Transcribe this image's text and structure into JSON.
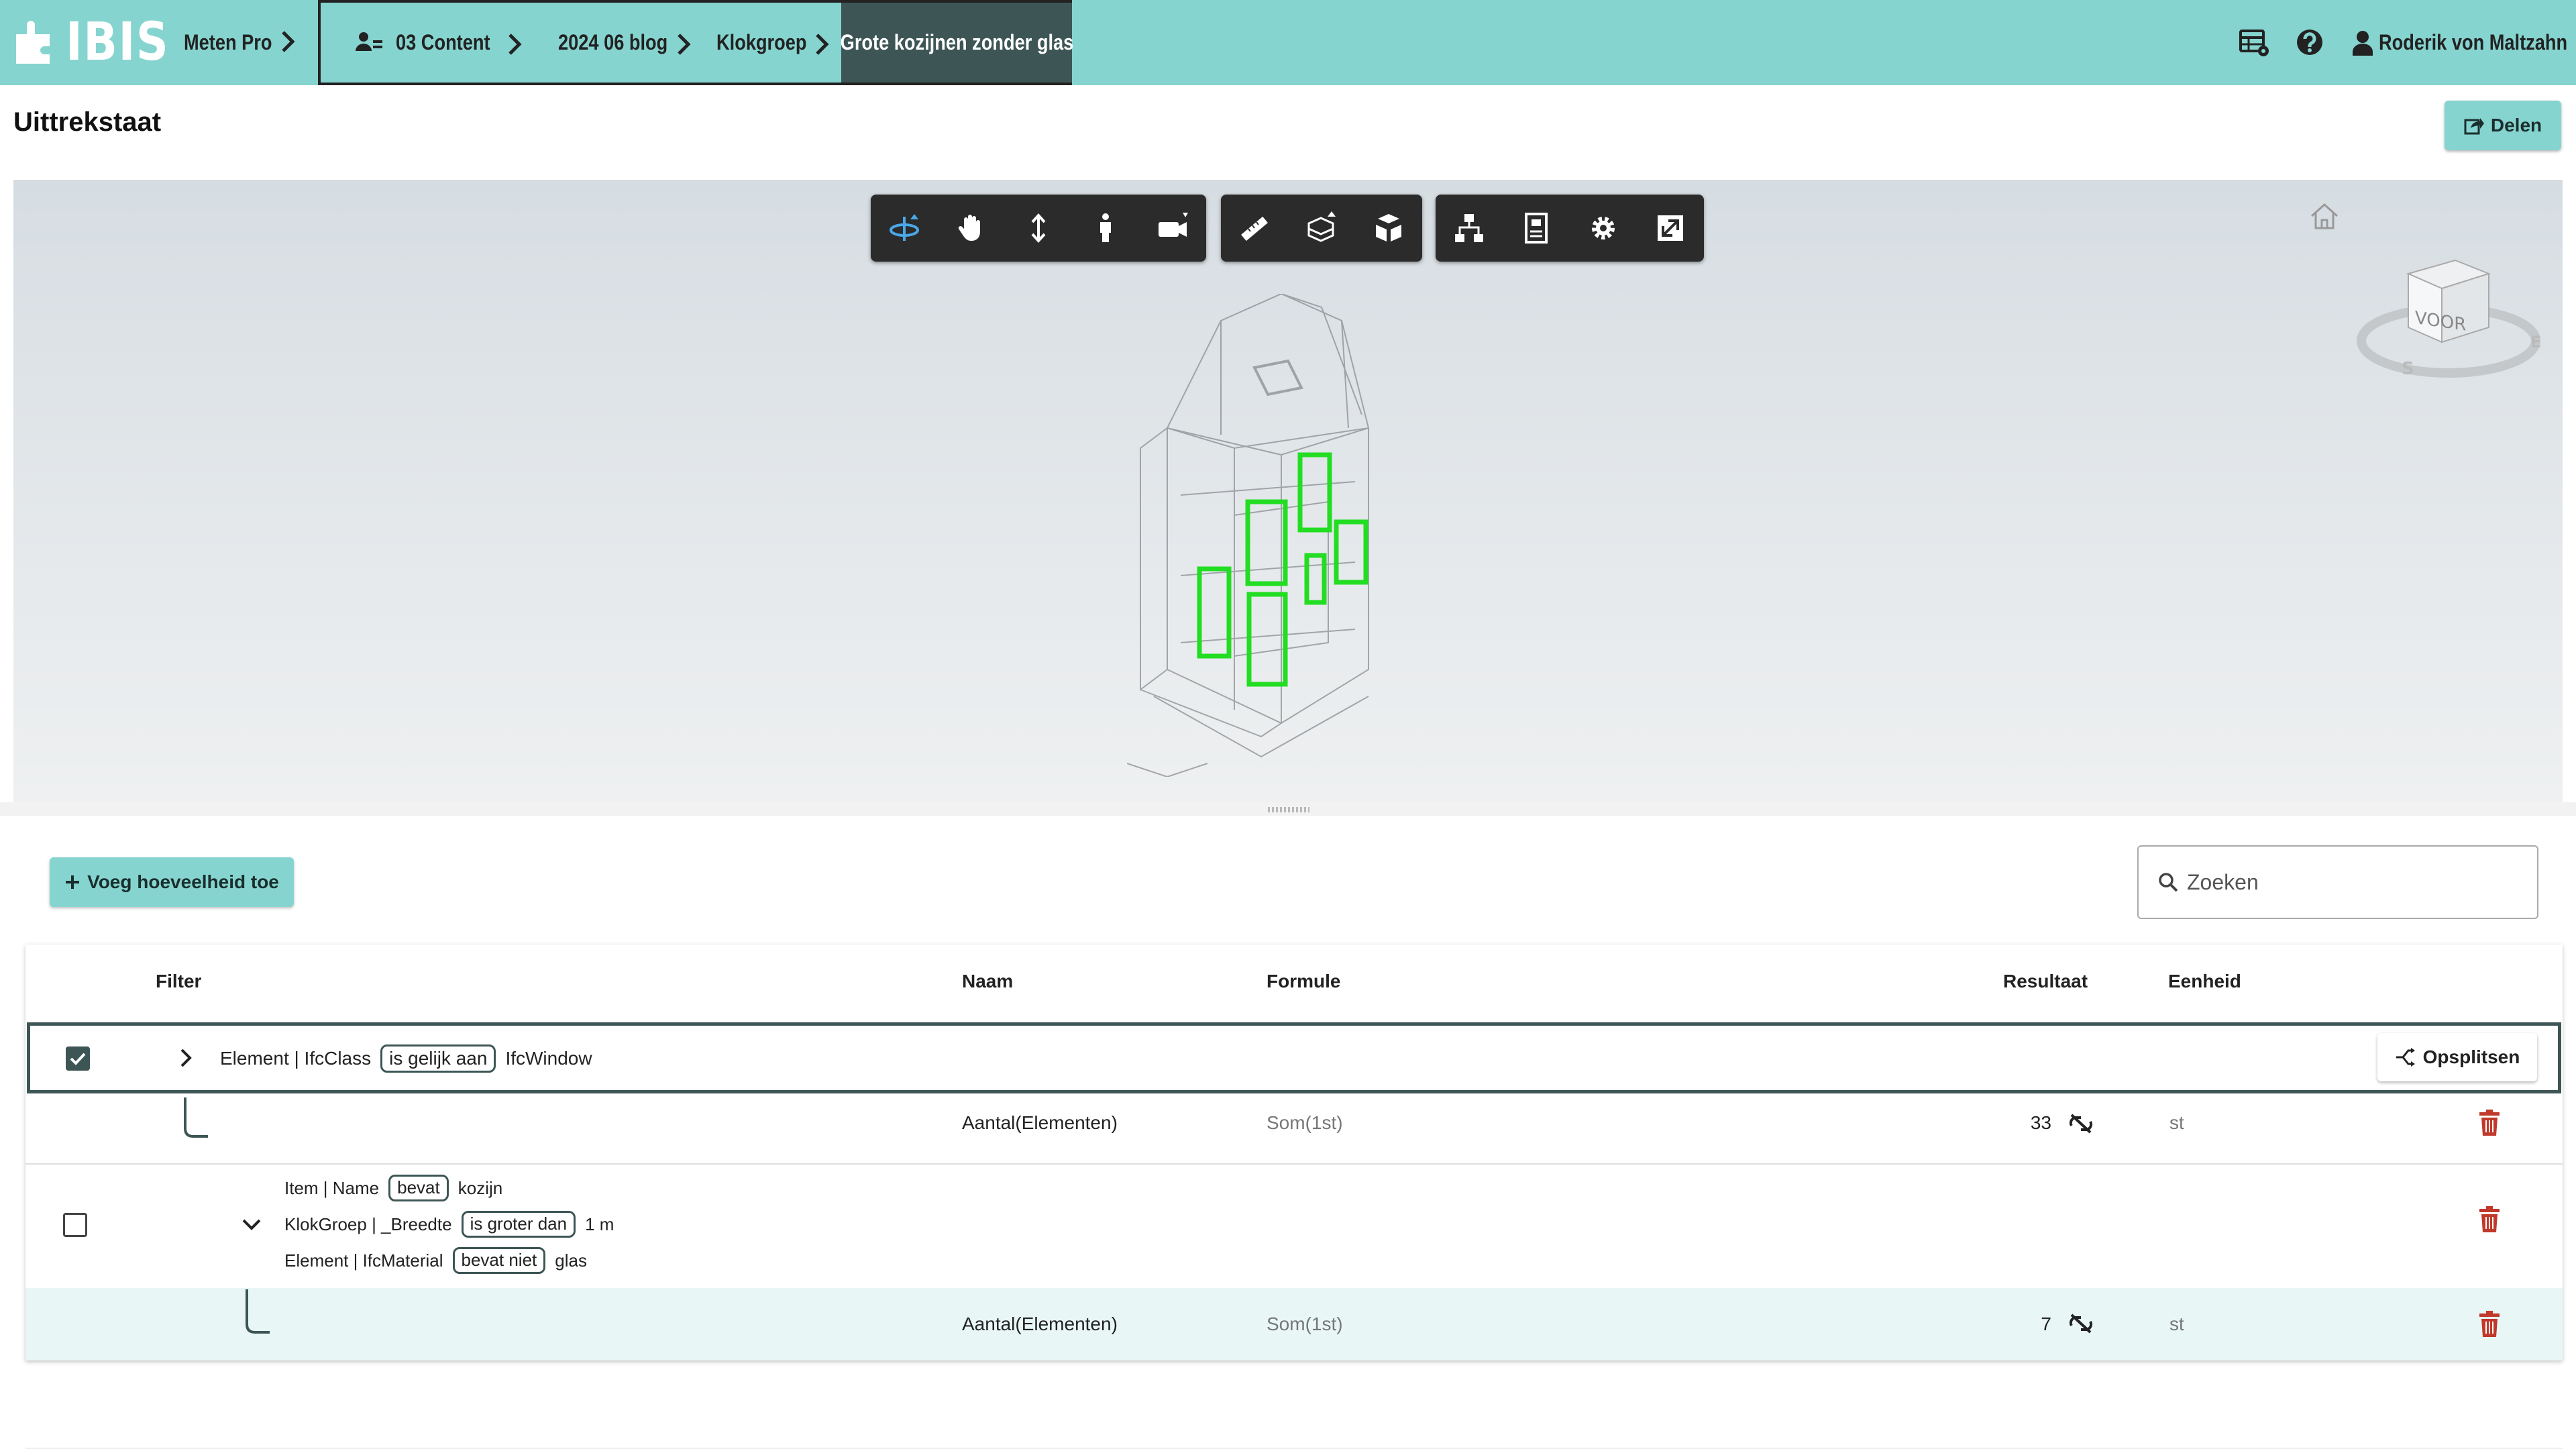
{
  "app": {
    "logo_text": "IBIS"
  },
  "breadcrumb": {
    "root": "Meten Pro",
    "items": [
      "03 Content",
      "2024 06 blog",
      "Klokgroep"
    ],
    "active": "Grote kozijnen zonder glas"
  },
  "header": {
    "user_name": "Roderik von Maltzahn"
  },
  "page": {
    "title": "Uittrekstaat",
    "share_label": "Delen"
  },
  "viewer": {
    "viewcube_label": "VOOR",
    "toolbar_icons": [
      "orbit-icon",
      "pan-icon",
      "zoom-icon",
      "first-person-icon",
      "camera-icon",
      "measure-icon",
      "section-icon",
      "explode-icon",
      "model-tree-icon",
      "properties-icon",
      "settings-icon",
      "fullscreen-icon"
    ]
  },
  "quantities": {
    "add_label": "Voeg hoeveelheid toe",
    "search_placeholder": "Zoeken",
    "columns": {
      "filter": "Filter",
      "name": "Naam",
      "formula": "Formule",
      "result": "Resultaat",
      "unit": "Eenheid"
    },
    "split_label": "Opsplitsen",
    "groups": [
      {
        "checked": true,
        "expanded": false,
        "filters": [
          {
            "field": "Element | IfcClass",
            "operator": "is gelijk aan",
            "value": "IfcWindow"
          }
        ],
        "quantity": {
          "name": "Aantal(Elementen)",
          "formula": "Som(1st)",
          "result": "33",
          "unit": "st"
        }
      },
      {
        "checked": false,
        "expanded": true,
        "filters": [
          {
            "field": "Item | Name",
            "operator": "bevat",
            "value": "kozijn"
          },
          {
            "field": "KlokGroep | _Breedte",
            "operator": "is groter dan",
            "value": "1 m"
          },
          {
            "field": "Element | IfcMaterial",
            "operator": "bevat niet",
            "value": "glas"
          }
        ],
        "quantity": {
          "name": "Aantal(Elementen)",
          "formula": "Som(1st)",
          "result": "7",
          "unit": "st"
        }
      }
    ]
  },
  "colors": {
    "accent": "#86d4cf",
    "dark": "#3d5555",
    "highlight_row": "#e8f6f6",
    "delete": "#c0392b",
    "selection_green": "#22dd22"
  }
}
